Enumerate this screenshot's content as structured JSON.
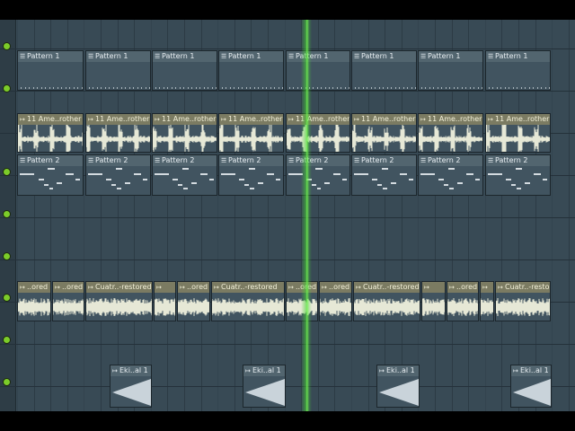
{
  "playlist": {
    "tracks": [
      {
        "clip_kind": "pattern",
        "clips": [
          {
            "label": "Pattern 1"
          },
          {
            "label": "Pattern 1"
          },
          {
            "label": "Pattern 1"
          },
          {
            "label": "Pattern 1"
          },
          {
            "label": "Pattern 1"
          },
          {
            "label": "Pattern 1"
          },
          {
            "label": "Pattern 1"
          },
          {
            "label": "Pattern 1"
          }
        ]
      },
      {
        "clip_kind": "audio",
        "clips": [
          {
            "label": "11 Ame..rother"
          },
          {
            "label": "11 Ame..rother"
          },
          {
            "label": "11 Ame..rother"
          },
          {
            "label": "11 Ame..rother"
          },
          {
            "label": "11 Ame..rother"
          },
          {
            "label": "11 Ame..rother"
          },
          {
            "label": "11 Ame..rother"
          },
          {
            "label": "11 Ame..rother"
          }
        ]
      },
      {
        "clip_kind": "pattern",
        "clips": [
          {
            "label": "Pattern 2"
          },
          {
            "label": "Pattern 2"
          },
          {
            "label": "Pattern 2"
          },
          {
            "label": "Pattern 2"
          },
          {
            "label": "Pattern 2"
          },
          {
            "label": "Pattern 2"
          },
          {
            "label": "Pattern 2"
          },
          {
            "label": "Pattern 2"
          }
        ]
      },
      {
        "clip_kind": "empty",
        "clips": []
      },
      {
        "clip_kind": "empty",
        "clips": []
      },
      {
        "clip_kind": "audio",
        "clips": [
          {
            "label": "..ored"
          },
          {
            "label": "..ored"
          },
          {
            "label": "Cuatr..-restored"
          },
          {
            "label": ""
          },
          {
            "label": "..ored"
          },
          {
            "label": "Cuatr..-restored"
          },
          {
            "label": "..ored"
          },
          {
            "label": "..ored"
          },
          {
            "label": "Cuatr..-restored"
          },
          {
            "label": ""
          },
          {
            "label": "..ored"
          },
          {
            "label": ""
          },
          {
            "label": "Cuatr..-restored"
          }
        ]
      },
      {
        "clip_kind": "empty",
        "clips": []
      },
      {
        "clip_kind": "sample",
        "clips": [
          {
            "label": "Eki..al 1"
          },
          {
            "label": "Eki..al 1"
          },
          {
            "label": "Eki..al 1"
          },
          {
            "label": "Eki..al 1"
          }
        ]
      },
      {
        "clip_kind": "empty",
        "clips": []
      }
    ]
  },
  "icons": {
    "pattern_clip": "pattern-icon",
    "audio_clip": "audio-clip-icon",
    "mute_dot": "track-mute-led-icon"
  },
  "colors": {
    "background": "#384a55",
    "track_led": "#7ccc2a",
    "playhead": "#6ee050",
    "audio_header": "#7b7b62",
    "waveform": "#e6e8d6"
  }
}
